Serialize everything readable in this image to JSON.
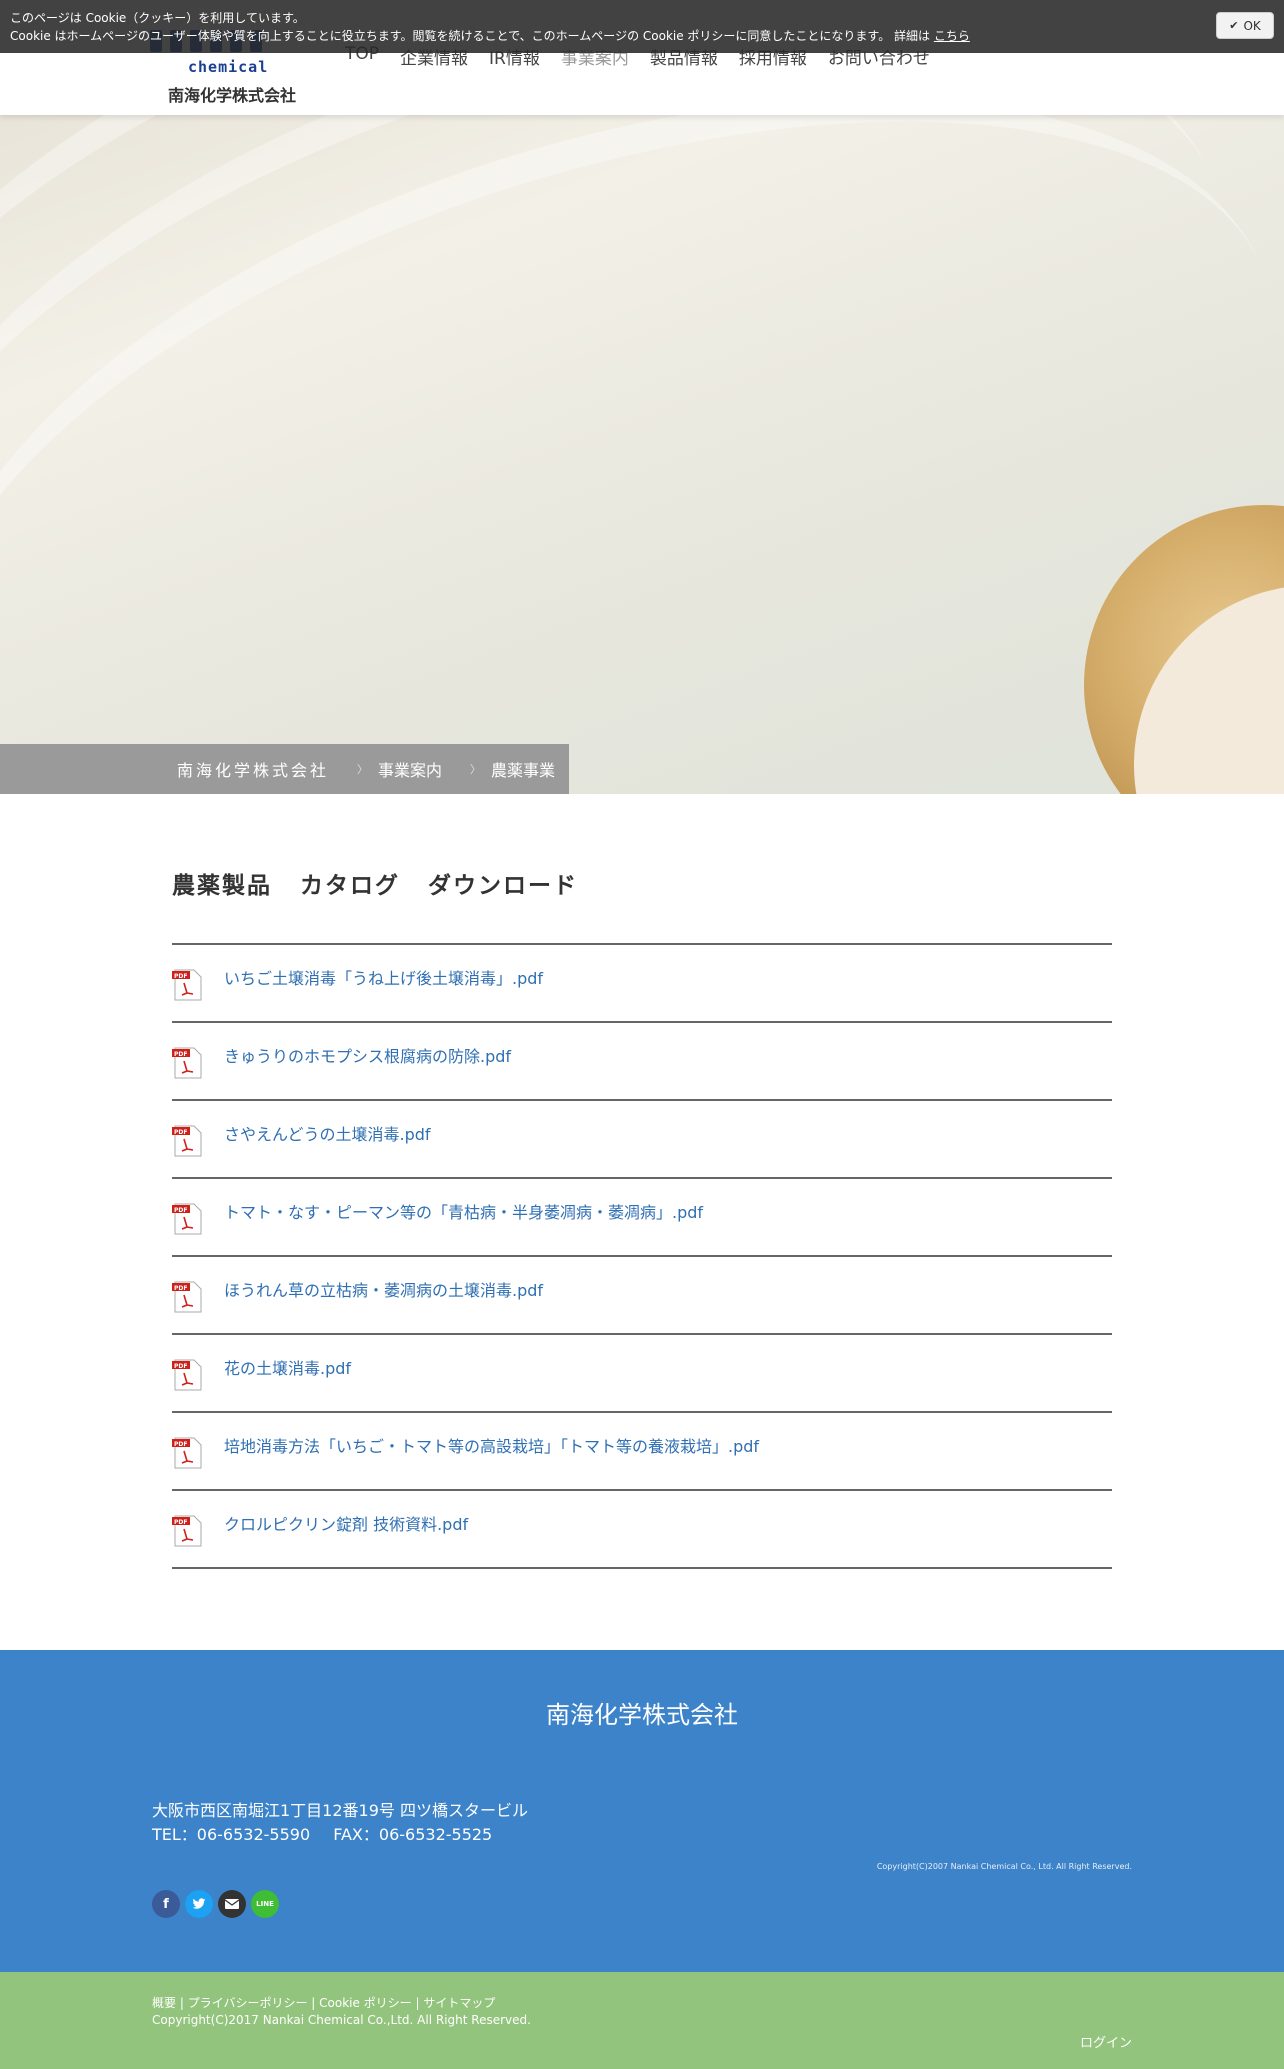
{
  "cookie": {
    "line1": "このページは Cookie（クッキー）を利用しています。",
    "line2": "Cookie はホームページのユーザー体験や質を向上することに役立ちます。閲覧を続けることで、このホームページの Cookie ポリシーに同意したことになります。 詳細は",
    "link": "こちら",
    "ok": "OK"
  },
  "header": {
    "logo_sub": "chemical",
    "logo_company": "南海化学株式会社",
    "nav": [
      "TOP",
      "企業情報",
      "IR情報",
      "事業案内",
      "製品情報",
      "採用情報",
      "お問い合わせ"
    ],
    "active_nav": "事業案内"
  },
  "breadcrumb": [
    "南海化学株式会社",
    "事業案内",
    "農薬事業"
  ],
  "main": {
    "title": "農薬製品 カタログ ダウンロード",
    "pdf_items": [
      "いちご土壌消毒「うね上げ後土壌消毒」.pdf",
      "きゅうりのホモプシス根腐病の防除.pdf",
      "さやえんどうの土壌消毒.pdf",
      "トマト・なす・ピーマン等の「青枯病・半身萎凋病・萎凋病」.pdf",
      "ほうれん草の立枯病・萎凋病の土壌消毒.pdf",
      "花の土壌消毒.pdf",
      "培地消毒方法「いちご・トマト等の高設栽培」「トマト等の養液栽培」.pdf",
      " クロルピクリン錠剤 技術資料.pdf"
    ]
  },
  "footer": {
    "company": "南海化学株式会社",
    "address": "大阪市西区南堀江1丁目12番19号 四ツ橋スタービル",
    "tel": "TEL：06-6532-5590",
    "fax": "FAX：06-6532-5525",
    "copyright_small": "Copyright(C)2007 Nankai Chemical Co., Ltd. All Right Reserved.",
    "links": [
      "概要",
      "プライバシーポリシー",
      "Cookie ポリシー",
      "サイトマップ"
    ],
    "copyright": "Copyright(C)2017 Nankai Chemical Co.,Ltd. All Right Reserved.",
    "login": "ログイン"
  },
  "colors": {
    "link_blue": "#2f6fb3",
    "footer_blue": "#3c83c9",
    "footer_green": "#93c47d",
    "breadcrumb_gray": "#9a9a9a"
  }
}
